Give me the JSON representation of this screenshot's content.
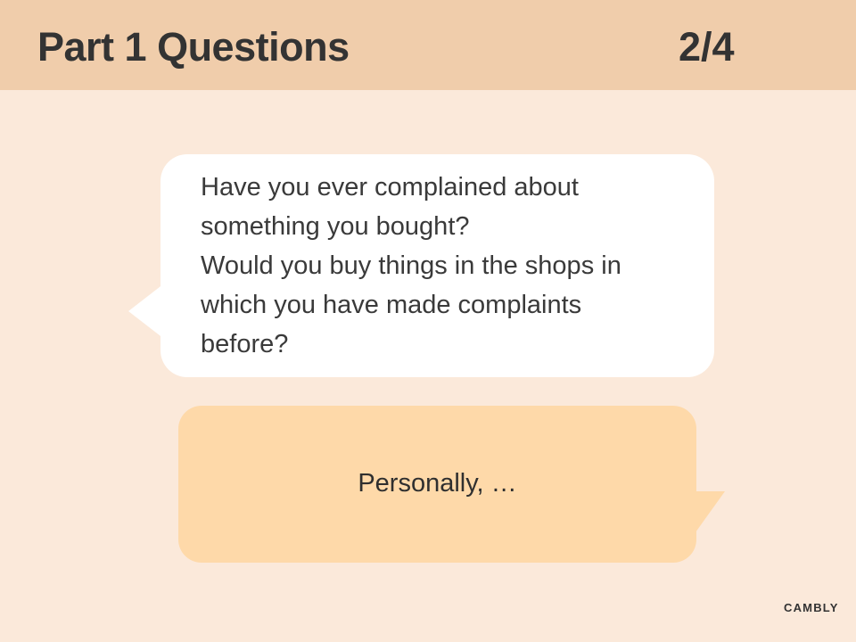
{
  "header": {
    "title": "Part 1 Questions",
    "counter": "2/4"
  },
  "question": {
    "lines": [
      "Have you ever complained about",
      "something you bought?",
      "Would you buy things in the shops in",
      "which you have made complaints",
      "before?"
    ]
  },
  "answer": {
    "prompt": "Personally, …"
  },
  "brand": {
    "logo_text": "CAMBLY"
  },
  "colors": {
    "background": "#fbe9da",
    "header": "#f0cdab",
    "question_bubble": "#ffffff",
    "answer_bubble": "#fed9a9",
    "text": "#333333"
  }
}
